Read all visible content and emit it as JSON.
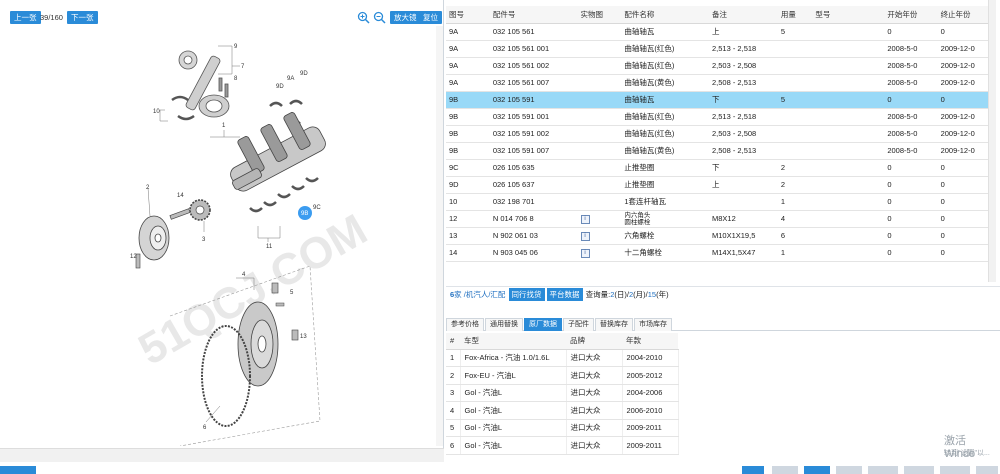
{
  "toolbar": {
    "prev_label": "上一张",
    "page_counter": "39/160",
    "next_label": "下一张",
    "zoom_in_icon": "zoom-in-icon",
    "zoom_out_icon": "zoom-out-icon",
    "enlarge_label": "放大镜",
    "reset_label": "复位"
  },
  "diagram": {
    "callouts": [
      "9",
      "7",
      "8",
      "10",
      "1",
      "9A",
      "9D",
      "9D",
      "9C",
      "9B",
      "2",
      "14",
      "3",
      "11",
      "12",
      "4",
      "5",
      "13",
      "6"
    ],
    "highlight": "9B",
    "watermark": "51QCJ.COM"
  },
  "parts_table": {
    "headers": [
      "图号",
      "配件号",
      "实物图",
      "配件名称",
      "备注",
      "用量",
      "型号",
      "开始年份",
      "终止年份"
    ],
    "rows": [
      {
        "fig": "9A",
        "part": "032 105 561",
        "img": "",
        "name": "曲轴轴瓦",
        "note": "上",
        "qty": "5",
        "model": "",
        "start": "0",
        "end": "0",
        "selected": false
      },
      {
        "fig": "9A",
        "part": "032 105 561 001",
        "img": "",
        "name": "曲轴轴瓦(红色)",
        "note": "2,513 - 2,518",
        "qty": "",
        "model": "",
        "start": "2008-5-0",
        "end": "2009-12-0",
        "selected": false
      },
      {
        "fig": "9A",
        "part": "032 105 561 002",
        "img": "",
        "name": "曲轴轴瓦(红色)",
        "note": "2,503 - 2,508",
        "qty": "",
        "model": "",
        "start": "2008-5-0",
        "end": "2009-12-0",
        "selected": false
      },
      {
        "fig": "9A",
        "part": "032 105 561 007",
        "img": "",
        "name": "曲轴轴瓦(黄色)",
        "note": "2,508 - 2,513",
        "qty": "",
        "model": "",
        "start": "2008-5-0",
        "end": "2009-12-0",
        "selected": false
      },
      {
        "fig": "9B",
        "part": "032 105 591",
        "img": "",
        "name": "曲轴轴瓦",
        "note": "下",
        "qty": "5",
        "model": "",
        "start": "0",
        "end": "0",
        "selected": true
      },
      {
        "fig": "9B",
        "part": "032 105 591 001",
        "img": "",
        "name": "曲轴轴瓦(红色)",
        "note": "2,513 - 2,518",
        "qty": "",
        "model": "",
        "start": "2008-5-0",
        "end": "2009-12-0",
        "selected": false
      },
      {
        "fig": "9B",
        "part": "032 105 591 002",
        "img": "",
        "name": "曲轴轴瓦(红色)",
        "note": "2,503 - 2,508",
        "qty": "",
        "model": "",
        "start": "2008-5-0",
        "end": "2009-12-0",
        "selected": false
      },
      {
        "fig": "9B",
        "part": "032 105 591 007",
        "img": "",
        "name": "曲轴轴瓦(黄色)",
        "note": "2,508 - 2,513",
        "qty": "",
        "model": "",
        "start": "2008-5-0",
        "end": "2009-12-0",
        "selected": false
      },
      {
        "fig": "9C",
        "part": "026 105 635",
        "img": "",
        "name": "止推垫圈",
        "note": "下",
        "qty": "2",
        "model": "",
        "start": "0",
        "end": "0",
        "selected": false
      },
      {
        "fig": "9D",
        "part": "026 105 637",
        "img": "",
        "name": "止推垫圈",
        "note": "上",
        "qty": "2",
        "model": "",
        "start": "0",
        "end": "0",
        "selected": false
      },
      {
        "fig": "10",
        "part": "032 198 701",
        "img": "",
        "name": "1套连杆轴瓦",
        "note": "",
        "qty": "1",
        "model": "",
        "start": "0",
        "end": "0",
        "selected": false
      },
      {
        "fig": "12",
        "part": "N  014 706 8",
        "img": "info-icon",
        "name": "内六角头\n圆柱螺栓",
        "note": "M8X12",
        "qty": "4",
        "model": "",
        "start": "0",
        "end": "0",
        "selected": false
      },
      {
        "fig": "13",
        "part": "N  902 061 03",
        "img": "info-icon",
        "name": "六角螺栓",
        "note": "M10X1X19,5",
        "qty": "6",
        "model": "",
        "start": "0",
        "end": "0",
        "selected": false
      },
      {
        "fig": "14",
        "part": "N  903 045 06",
        "img": "info-icon",
        "name": "十二角螺栓",
        "note": "M14X1,5X47",
        "qty": "1",
        "model": "",
        "start": "0",
        "end": "0",
        "selected": false
      }
    ]
  },
  "linkbar": {
    "count": "6",
    "suffix": "家 /",
    "links": "机汽人/汇配",
    "btn1": "同行找货",
    "btn2": "平台数据",
    "query_prefix": "查询量:",
    "q_day": "2",
    "q_day_unit": "(日)/",
    "q_month": "2",
    "q_month_unit": "(月)/",
    "q_year": "15",
    "q_year_unit": "(年)"
  },
  "tabs": [
    {
      "label": "参考价格",
      "active": false
    },
    {
      "label": "通用替换",
      "active": false
    },
    {
      "label": "原厂数据",
      "active": true
    },
    {
      "label": "子配件",
      "active": false
    },
    {
      "label": "替换库存",
      "active": false
    },
    {
      "label": "市场库存",
      "active": false
    }
  ],
  "vehicles": {
    "headers": [
      "#",
      "车型",
      "品牌",
      "年款"
    ],
    "rows": [
      [
        "1",
        "Fox-Africa - 汽油 1.0/1.6L",
        "进口大众",
        "2004-2010"
      ],
      [
        "2",
        "Fox-EU - 汽油L",
        "进口大众",
        "2005-2012"
      ],
      [
        "3",
        "Gol - 汽油L",
        "进口大众",
        "2004-2006"
      ],
      [
        "4",
        "Gol - 汽油L",
        "进口大众",
        "2006-2010"
      ],
      [
        "5",
        "Gol - 汽油L",
        "进口大众",
        "2009-2011"
      ],
      [
        "6",
        "Gol - 汽油L",
        "进口大众",
        "2009-2011"
      ]
    ]
  },
  "watermark_os": {
    "line1": "激活 Windo",
    "line2": "转到\"设置\"以..."
  },
  "colors": {
    "accent": "#2a8bd8",
    "selected_row": "#99d9f7"
  }
}
